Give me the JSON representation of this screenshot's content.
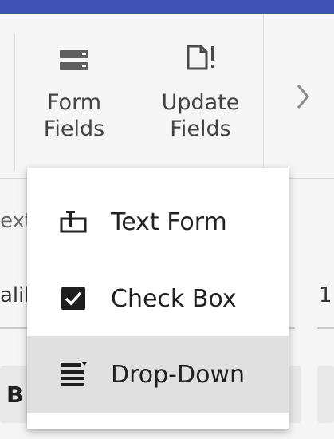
{
  "ribbon": {
    "form_fields": {
      "label": "Form\nFields",
      "icon": "form-fields-icon"
    },
    "update_fields": {
      "label": "Update\nFields",
      "icon": "update-fields-icon"
    },
    "more": {
      "icon": "chevron-right-icon"
    }
  },
  "background": {
    "partial_text_1": "ext",
    "partial_text_2": "alil",
    "partial_text_3": "1",
    "partial_bold": "B"
  },
  "menu": {
    "items": [
      {
        "label": "Text Form",
        "icon": "text-form-icon",
        "selected": false
      },
      {
        "label": "Check Box",
        "icon": "check-box-icon",
        "selected": false
      },
      {
        "label": "Drop-Down",
        "icon": "drop-down-icon",
        "selected": true
      }
    ]
  },
  "colors": {
    "accent_bar": "#3f51b5",
    "selected_bg": "#e0e0e0"
  }
}
